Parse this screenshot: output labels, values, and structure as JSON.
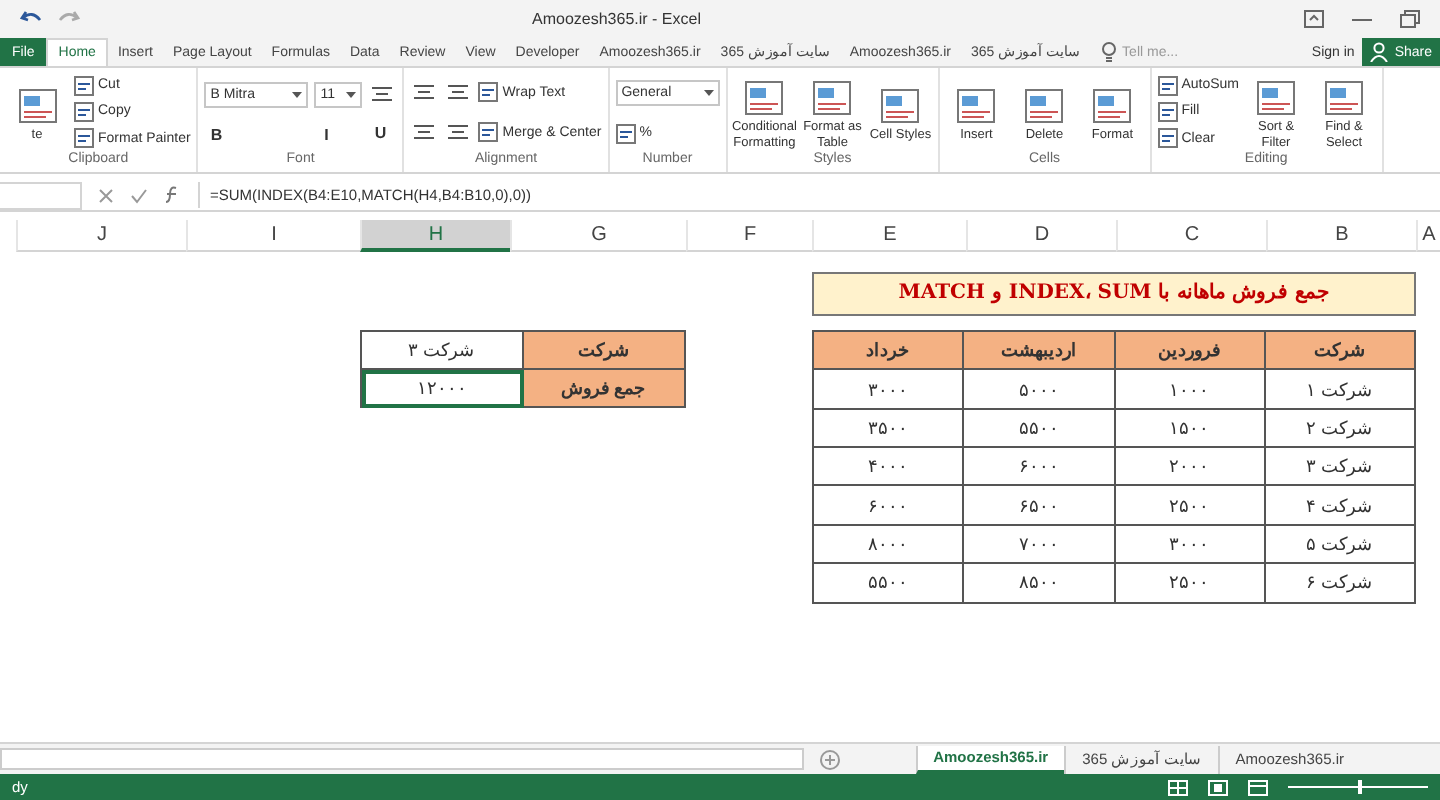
{
  "window": {
    "title": "Amoozesh365.ir - Excel"
  },
  "ribbon_tabs": [
    {
      "label": "سایت آموزش 365",
      "selected": false,
      "kind": "tab"
    },
    {
      "label": "Amoozesh365.ir",
      "selected": false,
      "kind": "tab"
    },
    {
      "label": "سایت آموزش 365",
      "selected": false,
      "kind": "tab"
    },
    {
      "label": "Amoozesh365.ir",
      "selected": false,
      "kind": "tab"
    },
    {
      "label": "Developer",
      "selected": false,
      "kind": "tab"
    },
    {
      "label": "View",
      "selected": false,
      "kind": "tab"
    },
    {
      "label": "Review",
      "selected": false,
      "kind": "tab"
    },
    {
      "label": "Data",
      "selected": false,
      "kind": "tab"
    },
    {
      "label": "Formulas",
      "selected": false,
      "kind": "tab"
    },
    {
      "label": "Page Layout",
      "selected": false,
      "kind": "tab"
    },
    {
      "label": "Insert",
      "selected": false,
      "kind": "tab"
    },
    {
      "label": "Home",
      "selected": true,
      "kind": "tab"
    },
    {
      "label": "File",
      "selected": false,
      "kind": "file"
    }
  ],
  "tell_me": {
    "placeholder": "Tell me..."
  },
  "sign_in": "Sign in",
  "share": "Share",
  "ribbon_groups": [
    {
      "name": "Editing",
      "columns": [
        [
          {
            "kind": "large",
            "label": "Find & Select"
          }
        ],
        [
          {
            "kind": "large",
            "label": "Sort & Filter"
          }
        ],
        [
          {
            "kind": "small",
            "label": "AutoSum"
          },
          {
            "kind": "small",
            "label": "Fill"
          },
          {
            "kind": "small",
            "label": "Clear"
          }
        ]
      ]
    },
    {
      "name": "Cells",
      "columns": [
        [
          {
            "kind": "large",
            "label": "Format"
          }
        ],
        [
          {
            "kind": "large",
            "label": "Delete"
          }
        ],
        [
          {
            "kind": "large",
            "label": "Insert"
          }
        ]
      ]
    },
    {
      "name": "Styles",
      "columns": [
        [
          {
            "kind": "large",
            "label": "Cell Styles"
          }
        ],
        [
          {
            "kind": "large",
            "label": "Format as Table"
          }
        ],
        [
          {
            "kind": "large",
            "label": "Conditional Formatting"
          }
        ]
      ]
    },
    {
      "name": "Number",
      "columns": [
        [
          {
            "kind": "field",
            "label": "General"
          },
          {
            "kind": "small",
            "label": "%"
          }
        ]
      ]
    },
    {
      "name": "Alignment",
      "columns": [
        [
          {
            "kind": "small",
            "label": "Wrap Text"
          },
          {
            "kind": "small",
            "label": "Merge & Center"
          }
        ],
        [
          {
            "kind": "tool"
          },
          {
            "kind": "tool"
          }
        ],
        [
          {
            "kind": "tool"
          },
          {
            "kind": "tool"
          }
        ]
      ]
    },
    {
      "name": "Font",
      "columns": [
        [
          {
            "kind": "tool"
          },
          {
            "kind": "glyph",
            "label": "U"
          }
        ],
        [
          {
            "kind": "spin",
            "label": "11"
          },
          {
            "kind": "glyph",
            "label": "I"
          }
        ],
        [
          {
            "kind": "field",
            "label": "B Mitra"
          },
          {
            "kind": "glyph",
            "label": "B"
          }
        ]
      ]
    },
    {
      "name": "Clipboard",
      "columns": [
        [
          {
            "kind": "small",
            "label": "Cut"
          },
          {
            "kind": "small",
            "label": "Copy"
          },
          {
            "kind": "small",
            "label": "Format Painter"
          }
        ],
        [
          {
            "kind": "large",
            "label": "te"
          }
        ]
      ]
    }
  ],
  "formula_bar": {
    "formula": "=SUM(INDEX(B4:E10,MATCH(H4,B4:B10,0),0))"
  },
  "columns": [
    {
      "label": "A",
      "selected": false
    },
    {
      "label": "B",
      "selected": false
    },
    {
      "label": "C",
      "selected": false
    },
    {
      "label": "D",
      "selected": false
    },
    {
      "label": "E",
      "selected": false
    },
    {
      "label": "F",
      "selected": false
    },
    {
      "label": "G",
      "selected": false
    },
    {
      "label": "H",
      "selected": true
    },
    {
      "label": "I",
      "selected": false
    },
    {
      "label": "J",
      "selected": false
    }
  ],
  "sales_table": {
    "title": "جمع فروش ماهانه با INDEX، SUM و MATCH",
    "headers": [
      "شرکت",
      "فروردین",
      "اردیبهشت",
      "خرداد"
    ],
    "rows": [
      [
        "شرکت ۱",
        "۱۰۰۰",
        "۵۰۰۰",
        "۳۰۰۰"
      ],
      [
        "شرکت ۲",
        "۱۵۰۰",
        "۵۵۰۰",
        "۳۵۰۰"
      ],
      [
        "شرکت ۳",
        "۲۰۰۰",
        "۶۰۰۰",
        "۴۰۰۰"
      ],
      [
        "شرکت ۴",
        "۲۵۰۰",
        "۶۵۰۰",
        "۶۰۰۰"
      ],
      [
        "شرکت ۵",
        "۳۰۰۰",
        "۷۰۰۰",
        "۸۰۰۰"
      ],
      [
        "شرکت ۶",
        "۲۵۰۰",
        "۸۵۰۰",
        "۵۵۰۰"
      ]
    ]
  },
  "lookup_table": [
    {
      "label": "شرکت",
      "value": "شرکت ۳",
      "selected": false
    },
    {
      "label": "جمع فروش",
      "value": "۱۲۰۰۰",
      "selected": true
    }
  ],
  "sheet_tabs": [
    {
      "label": "Amoozesh365.ir",
      "selected": false
    },
    {
      "label": "سایت آموزش 365",
      "selected": false
    },
    {
      "label": "Amoozesh365.ir",
      "selected": true
    }
  ],
  "status_bar": {
    "text": "dy",
    "zoom": {
      "level": 0.5
    }
  }
}
